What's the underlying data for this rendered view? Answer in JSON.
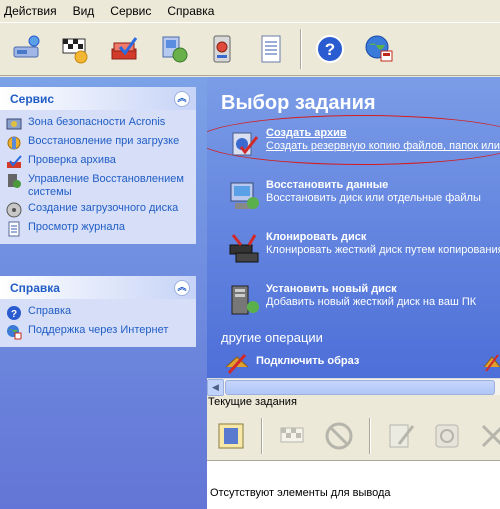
{
  "menu": [
    "Действия",
    "Вид",
    "Сервис",
    "Справка"
  ],
  "toolbar_icons": [
    {
      "name": "backup-wizard-icon",
      "color": "#4a78c8"
    },
    {
      "name": "race-flag-icon",
      "color": "#333333"
    },
    {
      "name": "check-archive-icon",
      "color": "#d23b2a"
    },
    {
      "name": "restore-pc-icon",
      "color": "#6a8fd0"
    },
    {
      "name": "disk-icon",
      "color": "#7a7a7a"
    },
    {
      "name": "log-icon",
      "color": "#ffffff"
    },
    {
      "name": "help-icon",
      "color": "#2a5bd0"
    },
    {
      "name": "internet-support-icon",
      "color": "#3b8d3b"
    }
  ],
  "service_panel": {
    "title": "Сервис",
    "items": [
      {
        "label": "Зона безопасности Acronis",
        "icon": "security-zone-icon"
      },
      {
        "label": "Восстановление при загрузке",
        "icon": "startup-recovery-icon"
      },
      {
        "label": "Проверка архива",
        "icon": "check-archive-icon"
      },
      {
        "label": "Управление Восстановлением системы",
        "icon": "system-restore-icon"
      },
      {
        "label": "Создание загрузочного диска",
        "icon": "bootable-disk-icon"
      },
      {
        "label": "Просмотр журнала",
        "icon": "log-view-icon"
      }
    ]
  },
  "help_panel": {
    "title": "Справка",
    "items": [
      {
        "label": "Справка",
        "icon": "help-icon"
      },
      {
        "label": "Поддержка через Интернет",
        "icon": "internet-support-icon"
      }
    ]
  },
  "main": {
    "title": "Выбор задания",
    "tasks": [
      {
        "title": "Создать архив",
        "desc": "Создать резервную копию файлов, папок или"
      },
      {
        "title": "Восстановить данные",
        "desc": "Восстановить диск или отдельные файлы"
      },
      {
        "title": "Клонировать диск",
        "desc": "Клонировать жесткий диск путем копирования"
      },
      {
        "title": "Установить новый диск",
        "desc": "Добавить новый жесткий диск на ваш ПК"
      }
    ],
    "other_ops_label": "другие операции",
    "other_ops": [
      {
        "title": "Подключить образ"
      }
    ]
  },
  "current_tasks": {
    "label": "Текущие задания",
    "empty_text": "Отсутствуют элементы для вывода"
  }
}
